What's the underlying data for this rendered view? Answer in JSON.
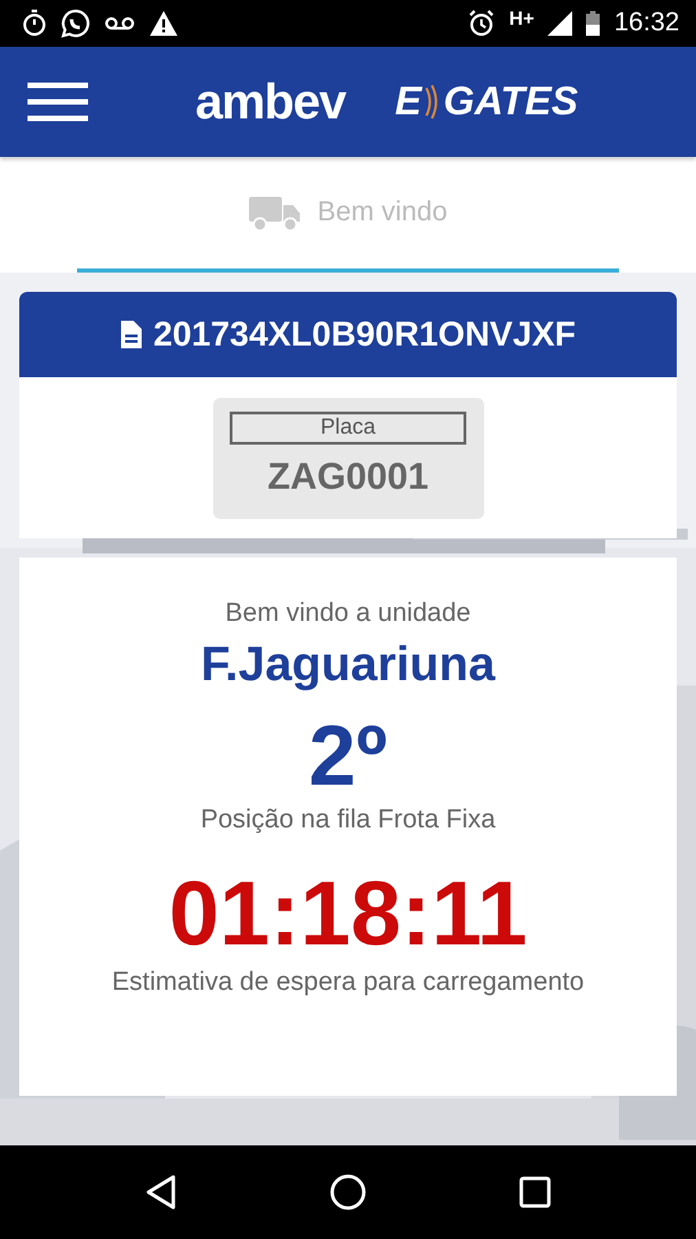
{
  "status_bar": {
    "network": "H+",
    "time": "16:32"
  },
  "header": {
    "brand": "ambev",
    "app_name_left": "E",
    "app_name_right": "GATES"
  },
  "tabs": [
    {
      "label": "Bem vindo",
      "selected": true
    }
  ],
  "ticket": {
    "code": "201734XL0B90R1ONVJXF",
    "plate_label": "Placa",
    "plate": "ZAG0001"
  },
  "queue": {
    "welcome": "Bem vindo a unidade",
    "unit": "F.Jaguariuna",
    "position": "2º",
    "position_label": "Posição na fila Frota Fixa",
    "wait_time": "01:18:11",
    "wait_label": "Estimativa de espera para carregamento"
  }
}
